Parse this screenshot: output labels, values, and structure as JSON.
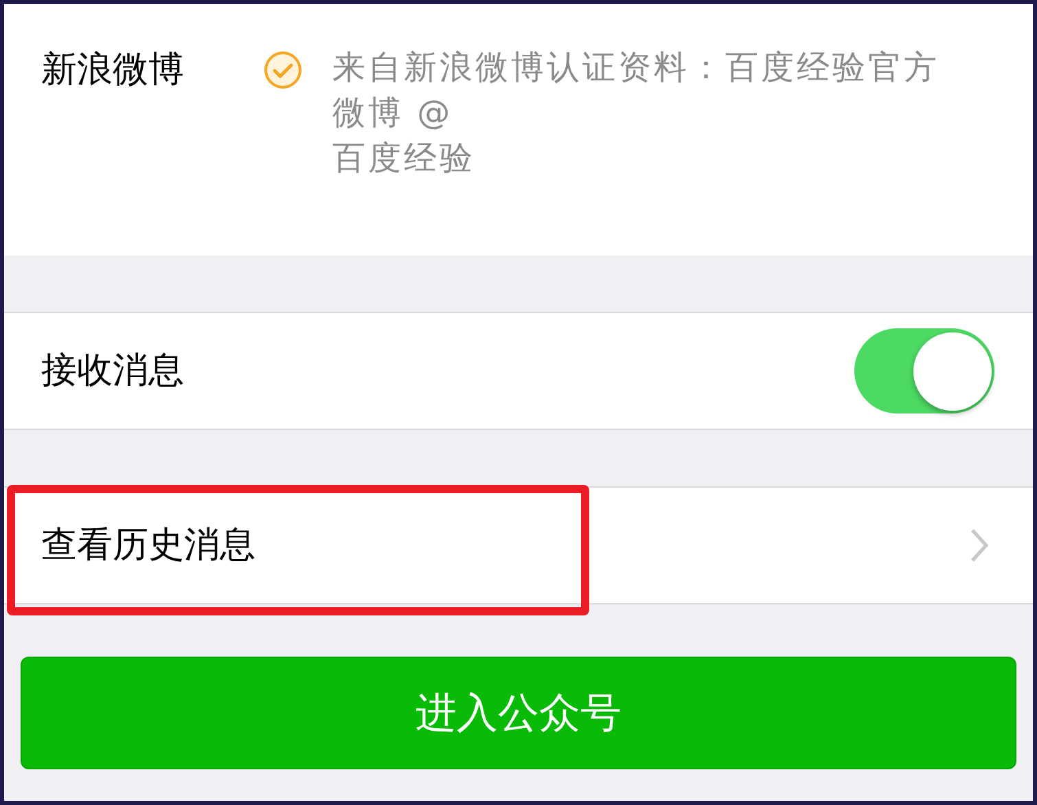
{
  "verification": {
    "label": "新浪微博",
    "verified": true,
    "text": "来自新浪微博认证资料：百度经验官方微博 @\n百度经验"
  },
  "settings": [
    {
      "kind": "toggle",
      "label": "接收消息",
      "on": true,
      "highlighted": false
    },
    {
      "kind": "link",
      "label": "查看历史消息",
      "highlighted": true
    }
  ],
  "enter_button": {
    "label": "进入公众号"
  }
}
